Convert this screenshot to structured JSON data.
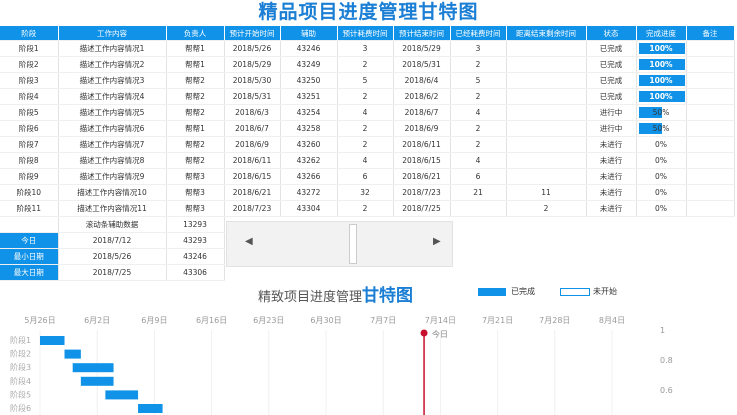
{
  "title": "精品项目进度管理甘特图",
  "colors": {
    "accent": "#0f92e8",
    "today_line": "#c8102e"
  },
  "table": {
    "headers": [
      "阶段",
      "工作内容",
      "负责人",
      "预计开始时间",
      "辅助",
      "预计耗费时间",
      "预计结束时间",
      "已经耗费时间",
      "距离结束剩余时间",
      "状态",
      "完成进度",
      "备注"
    ],
    "rows": [
      {
        "stage": "阶段1",
        "content": "描述工作内容情况1",
        "owner": "帮帮1",
        "start": "2018/5/26",
        "aux": "43246",
        "plan": "3",
        "end": "2018/5/29",
        "spent": "3",
        "remain": "",
        "status": "已完成",
        "progress": 1.0,
        "progress_label": "100%"
      },
      {
        "stage": "阶段2",
        "content": "描述工作内容情况2",
        "owner": "帮帮1",
        "start": "2018/5/29",
        "aux": "43249",
        "plan": "2",
        "end": "2018/5/31",
        "spent": "2",
        "remain": "",
        "status": "已完成",
        "progress": 1.0,
        "progress_label": "100%"
      },
      {
        "stage": "阶段3",
        "content": "描述工作内容情况3",
        "owner": "帮帮2",
        "start": "2018/5/30",
        "aux": "43250",
        "plan": "5",
        "end": "2018/6/4",
        "spent": "5",
        "remain": "",
        "status": "已完成",
        "progress": 1.0,
        "progress_label": "100%"
      },
      {
        "stage": "阶段4",
        "content": "描述工作内容情况4",
        "owner": "帮帮2",
        "start": "2018/5/31",
        "aux": "43251",
        "plan": "2",
        "end": "2018/6/2",
        "spent": "2",
        "remain": "",
        "status": "已完成",
        "progress": 1.0,
        "progress_label": "100%"
      },
      {
        "stage": "阶段5",
        "content": "描述工作内容情况5",
        "owner": "帮帮2",
        "start": "2018/6/3",
        "aux": "43254",
        "plan": "4",
        "end": "2018/6/7",
        "spent": "4",
        "remain": "",
        "status": "进行中",
        "progress": 0.5,
        "progress_label": "50%"
      },
      {
        "stage": "阶段6",
        "content": "描述工作内容情况6",
        "owner": "帮帮1",
        "start": "2018/6/7",
        "aux": "43258",
        "plan": "2",
        "end": "2018/6/9",
        "spent": "2",
        "remain": "",
        "status": "进行中",
        "progress": 0.5,
        "progress_label": "50%"
      },
      {
        "stage": "阶段7",
        "content": "描述工作内容情况7",
        "owner": "帮帮2",
        "start": "2018/6/9",
        "aux": "43260",
        "plan": "2",
        "end": "2018/6/11",
        "spent": "2",
        "remain": "",
        "status": "未进行",
        "progress": 0,
        "progress_label": "0%"
      },
      {
        "stage": "阶段8",
        "content": "描述工作内容情况8",
        "owner": "帮帮2",
        "start": "2018/6/11",
        "aux": "43262",
        "plan": "4",
        "end": "2018/6/15",
        "spent": "4",
        "remain": "",
        "status": "未进行",
        "progress": 0,
        "progress_label": "0%"
      },
      {
        "stage": "阶段9",
        "content": "描述工作内容情况9",
        "owner": "帮帮3",
        "start": "2018/6/15",
        "aux": "43266",
        "plan": "6",
        "end": "2018/6/21",
        "spent": "6",
        "remain": "",
        "status": "未进行",
        "progress": 0,
        "progress_label": "0%"
      },
      {
        "stage": "阶段10",
        "content": "描述工作内容情况10",
        "owner": "帮帮3",
        "start": "2018/6/21",
        "aux": "43272",
        "plan": "32",
        "end": "2018/7/23",
        "spent": "21",
        "remain": "11",
        "status": "未进行",
        "progress": 0,
        "progress_label": "0%"
      },
      {
        "stage": "阶段11",
        "content": "描述工作内容情况11",
        "owner": "帮帮3",
        "start": "2018/7/23",
        "aux": "43304",
        "plan": "2",
        "end": "2018/7/25",
        "spent": "",
        "remain": "2",
        "status": "未进行",
        "progress": 0,
        "progress_label": "0%"
      }
    ],
    "scroll_label": "滚动条辅助数据",
    "scroll_value": "13293",
    "summary": [
      {
        "label": "今日",
        "date": "2018/7/12",
        "num": "43293"
      },
      {
        "label": "最小日期",
        "date": "2018/5/26",
        "num": "43246"
      },
      {
        "label": "最大日期",
        "date": "2018/7/25",
        "num": "43306"
      }
    ]
  },
  "scrollbar": {
    "left_arrow": "◀",
    "right_arrow": "▶"
  },
  "chart": {
    "title_prefix": "精致项目进度管理",
    "title_bold": "甘特图",
    "legend_done": "已完成",
    "legend_todo": "未开始",
    "today_label": "今日",
    "date_ticks": [
      "5月26日",
      "6月2日",
      "6月9日",
      "6月16日",
      "6月23日",
      "6月30日",
      "7月7日",
      "7月14日",
      "7月21日",
      "7月28日",
      "8月4日"
    ],
    "y_right_ticks": [
      "1",
      "0.8",
      "0.6"
    ],
    "stage_labels": [
      "阶段1",
      "阶段2",
      "阶段3",
      "阶段4",
      "阶段5",
      "阶段6"
    ]
  },
  "chart_data": {
    "type": "bar",
    "orientation": "horizontal-gantt",
    "x_range": [
      "2018-05-26",
      "2018-08-04"
    ],
    "today": "2018-07-12",
    "tasks": [
      {
        "name": "阶段1",
        "start": "2018-05-26",
        "days": 3
      },
      {
        "name": "阶段2",
        "start": "2018-05-29",
        "days": 2
      },
      {
        "name": "阶段3",
        "start": "2018-05-30",
        "days": 5
      },
      {
        "name": "阶段4",
        "start": "2018-05-31",
        "days": 4
      },
      {
        "name": "阶段5",
        "start": "2018-06-03",
        "days": 4
      },
      {
        "name": "阶段6",
        "start": "2018-06-07",
        "days": 3
      }
    ]
  }
}
